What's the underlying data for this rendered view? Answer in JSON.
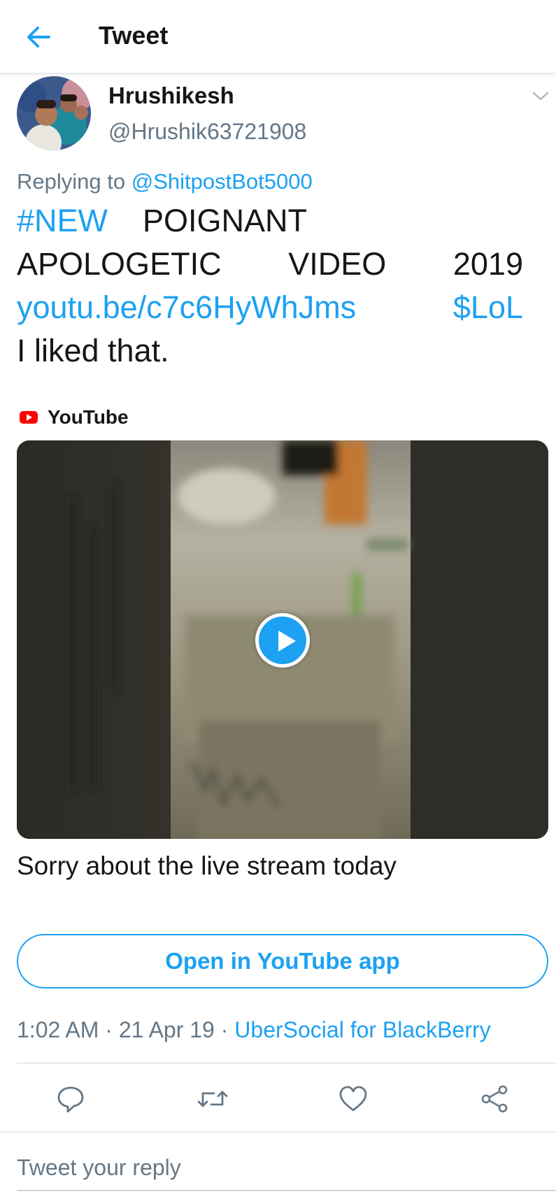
{
  "header": {
    "title": "Tweet"
  },
  "author": {
    "display_name": "Hrushikesh",
    "handle": "@Hrushik63721908"
  },
  "replying": {
    "prefix": "Replying to ",
    "mention": "@ShitpostBot5000"
  },
  "tweet": {
    "hashtag": "#NEW",
    "w_poignant": "POIGNANT",
    "w_apologetic": "APOLOGETIC",
    "w_video": "VIDEO",
    "w_year": "2019",
    "link": "youtu.be/c7c6HyWhJms",
    "cashtag": "$LoL",
    "last_line": "I liked that."
  },
  "card": {
    "source": "YouTube",
    "title": "Sorry about the live stream today",
    "open_label": "Open in YouTube app"
  },
  "meta": {
    "time": "1:02 AM",
    "sep1": " · ",
    "date": "21 Apr 19",
    "sep2": " · ",
    "source": "UberSocial for BlackBerry"
  },
  "reply": {
    "placeholder": "Tweet your reply"
  },
  "colors": {
    "accent": "#1da1f2",
    "secondary_text": "#657786",
    "youtube_red": "#ff0000"
  },
  "icons": {
    "back": "arrow-left-icon",
    "caret": "chevron-down-icon",
    "reply": "speech-bubble-icon",
    "retweet": "retweet-icon",
    "like": "heart-icon",
    "share": "share-icon",
    "play": "play-icon"
  }
}
